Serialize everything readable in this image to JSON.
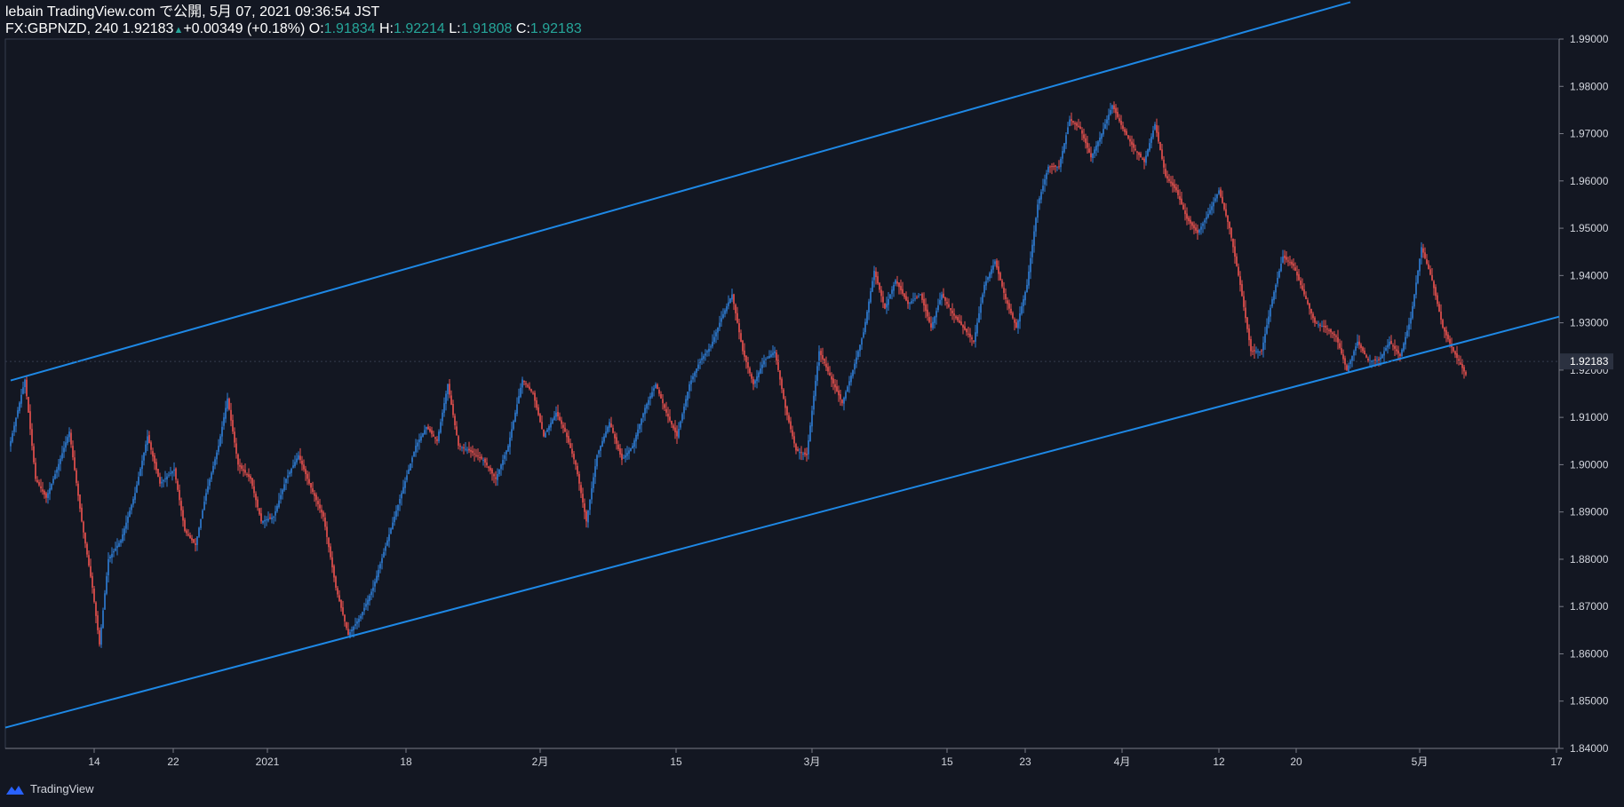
{
  "header": {
    "line1": "lebain TradingView.com で公開, 5月 07, 2021 09:36:54 JST",
    "symbol_prefix": "FX:GBPNZD, 240 ",
    "last": "1.92183",
    "arrow": "▲",
    "change": "+0.00349 (+0.18%)",
    "o_label": "O:",
    "o_value": "1.91834",
    "h_label": "H:",
    "h_value": "1.92214",
    "l_label": "L:",
    "l_value": "1.91808",
    "c_label": "C:",
    "c_value": "1.92183"
  },
  "footer": {
    "brand": "TradingView"
  },
  "colors": {
    "background": "#131722",
    "up": "#2f7fd8",
    "down": "#ef5350",
    "channel": "#1e88e5",
    "last_price_tag": "#2b3140"
  },
  "chart_data": {
    "type": "candlestick",
    "symbol": "FX:GBPNZD",
    "interval": "240",
    "x_tick_labels": [
      "14",
      "22",
      "2021",
      "18",
      "2月",
      "15",
      "3月",
      "15",
      "23",
      "4月",
      "12",
      "20",
      "5月",
      "17"
    ],
    "y_tick_labels": [
      "1.99000",
      "1.98000",
      "1.97000",
      "1.96000",
      "1.95000",
      "1.94000",
      "1.93000",
      "1.92000",
      "1.91000",
      "1.90000",
      "1.89000",
      "1.88000",
      "1.87000",
      "1.86000",
      "1.85000",
      "1.84000"
    ],
    "ylim": [
      1.84,
      1.99
    ],
    "last_price_label": "1.92183",
    "close_path": [
      [
        0,
        1.905
      ],
      [
        8,
        1.918
      ],
      [
        14,
        1.897
      ],
      [
        20,
        1.893
      ],
      [
        26,
        1.899
      ],
      [
        33,
        1.907
      ],
      [
        40,
        1.888
      ],
      [
        46,
        1.874
      ],
      [
        50,
        1.862
      ],
      [
        55,
        1.88
      ],
      [
        62,
        1.884
      ],
      [
        70,
        1.894
      ],
      [
        77,
        1.906
      ],
      [
        84,
        1.896
      ],
      [
        92,
        1.899
      ],
      [
        98,
        1.886
      ],
      [
        104,
        1.883
      ],
      [
        110,
        1.894
      ],
      [
        117,
        1.904
      ],
      [
        122,
        1.914
      ],
      [
        128,
        1.9
      ],
      [
        135,
        1.897
      ],
      [
        141,
        1.888
      ],
      [
        148,
        1.889
      ],
      [
        155,
        1.897
      ],
      [
        162,
        1.902
      ],
      [
        168,
        1.896
      ],
      [
        176,
        1.889
      ],
      [
        183,
        1.874
      ],
      [
        190,
        1.864
      ],
      [
        197,
        1.868
      ],
      [
        204,
        1.874
      ],
      [
        212,
        1.884
      ],
      [
        220,
        1.894
      ],
      [
        228,
        1.904
      ],
      [
        234,
        1.908
      ],
      [
        240,
        1.905
      ],
      [
        246,
        1.917
      ],
      [
        252,
        1.904
      ],
      [
        258,
        1.903
      ],
      [
        266,
        1.901
      ],
      [
        273,
        1.897
      ],
      [
        280,
        1.904
      ],
      [
        288,
        1.918
      ],
      [
        294,
        1.915
      ],
      [
        300,
        1.906
      ],
      [
        307,
        1.911
      ],
      [
        312,
        1.907
      ],
      [
        318,
        1.9
      ],
      [
        324,
        1.888
      ],
      [
        330,
        1.902
      ],
      [
        337,
        1.909
      ],
      [
        344,
        1.901
      ],
      [
        350,
        1.904
      ],
      [
        357,
        1.912
      ],
      [
        363,
        1.917
      ],
      [
        369,
        1.911
      ],
      [
        375,
        1.906
      ],
      [
        382,
        1.917
      ],
      [
        388,
        1.922
      ],
      [
        394,
        1.925
      ],
      [
        400,
        1.931
      ],
      [
        406,
        1.936
      ],
      [
        412,
        1.924
      ],
      [
        418,
        1.917
      ],
      [
        424,
        1.922
      ],
      [
        430,
        1.924
      ],
      [
        436,
        1.912
      ],
      [
        442,
        1.903
      ],
      [
        448,
        1.902
      ],
      [
        455,
        1.924
      ],
      [
        462,
        1.918
      ],
      [
        468,
        1.913
      ],
      [
        474,
        1.92
      ],
      [
        480,
        1.928
      ],
      [
        486,
        1.941
      ],
      [
        492,
        1.933
      ],
      [
        498,
        1.939
      ],
      [
        505,
        1.934
      ],
      [
        512,
        1.936
      ],
      [
        518,
        1.929
      ],
      [
        524,
        1.936
      ],
      [
        530,
        1.932
      ],
      [
        536,
        1.929
      ],
      [
        542,
        1.926
      ],
      [
        548,
        1.938
      ],
      [
        554,
        1.943
      ],
      [
        560,
        1.935
      ],
      [
        566,
        1.929
      ],
      [
        572,
        1.938
      ],
      [
        578,
        1.955
      ],
      [
        584,
        1.963
      ],
      [
        590,
        1.963
      ],
      [
        596,
        1.973
      ],
      [
        602,
        1.971
      ],
      [
        608,
        1.965
      ],
      [
        614,
        1.97
      ],
      [
        620,
        1.976
      ],
      [
        626,
        1.971
      ],
      [
        632,
        1.967
      ],
      [
        638,
        1.964
      ],
      [
        644,
        1.972
      ],
      [
        650,
        1.961
      ],
      [
        656,
        1.958
      ],
      [
        662,
        1.952
      ],
      [
        668,
        1.949
      ],
      [
        674,
        1.953
      ],
      [
        680,
        1.958
      ],
      [
        686,
        1.95
      ],
      [
        692,
        1.938
      ],
      [
        698,
        1.924
      ],
      [
        704,
        1.924
      ],
      [
        710,
        1.935
      ],
      [
        716,
        1.944
      ],
      [
        722,
        1.942
      ],
      [
        728,
        1.936
      ],
      [
        734,
        1.93
      ],
      [
        740,
        1.929
      ],
      [
        746,
        1.927
      ],
      [
        752,
        1.92
      ],
      [
        758,
        1.926
      ],
      [
        764,
        1.922
      ],
      [
        770,
        1.922
      ],
      [
        776,
        1.926
      ],
      [
        782,
        1.923
      ],
      [
        788,
        1.931
      ],
      [
        794,
        1.946
      ],
      [
        800,
        1.939
      ],
      [
        806,
        1.929
      ],
      [
        812,
        1.924
      ],
      [
        819,
        1.919
      ]
    ],
    "channel_upper": {
      "start": [
        "first bar",
        1.9178
      ],
      "end": [
        "top edge",
        1.9978
      ]
    },
    "channel_lower": {
      "start": [
        "left edge",
        1.8444
      ],
      "end": [
        "right edge",
        1.9313
      ]
    }
  }
}
